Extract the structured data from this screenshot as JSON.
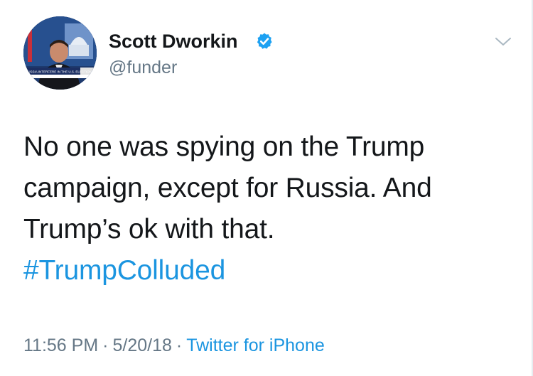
{
  "tweet": {
    "author": {
      "display_name": "Scott Dworkin",
      "handle": "@funder",
      "verified": true,
      "avatar_caption": "RUSSIA INTERFERE IN THE U.S. ELECTION?"
    },
    "text_lines": [
      "No one was spying on the Trump",
      "campaign, except for Russia. And",
      "Trump’s ok with that."
    ],
    "hashtag": "#TrumpColluded",
    "time": "11:56 PM",
    "date": "5/20/18",
    "separator": "·",
    "source": "Twitter for iPhone"
  },
  "colors": {
    "text": "#14171a",
    "secondary": "#657786",
    "link": "#1b95e0",
    "verified_badge": "#1da1f2"
  },
  "icons": {
    "verified": "verified-badge-icon",
    "menu": "chevron-down-icon"
  }
}
